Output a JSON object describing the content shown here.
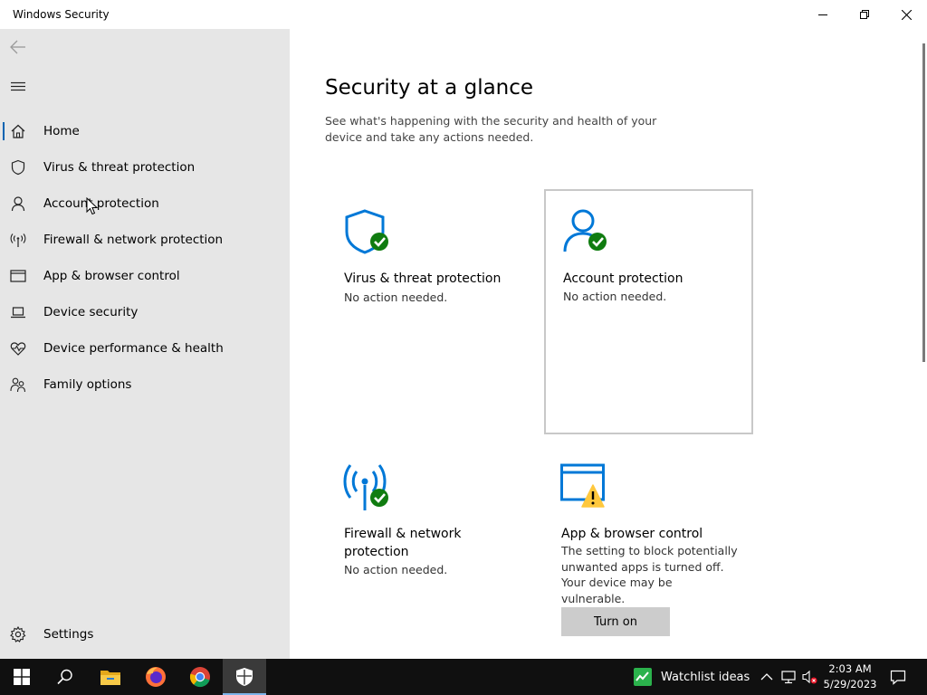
{
  "window": {
    "title": "Windows Security"
  },
  "sidebar": {
    "items": [
      {
        "label": "Home",
        "icon": "home-icon",
        "selected": true
      },
      {
        "label": "Virus & threat protection",
        "icon": "shield-icon"
      },
      {
        "label": "Account protection",
        "icon": "person-icon"
      },
      {
        "label": "Firewall & network protection",
        "icon": "antenna-icon"
      },
      {
        "label": "App & browser control",
        "icon": "browser-window-icon"
      },
      {
        "label": "Device security",
        "icon": "laptop-icon"
      },
      {
        "label": "Device performance & health",
        "icon": "heart-pulse-icon"
      },
      {
        "label": "Family options",
        "icon": "family-icon"
      }
    ],
    "settings_label": "Settings"
  },
  "main": {
    "title": "Security at a glance",
    "description": "See what's happening with the security and health of your device and take any actions needed.",
    "tiles": [
      {
        "title": "Virus & threat protection",
        "status": "No action needed.",
        "icon": "shield-check-icon"
      },
      {
        "title": "Account protection",
        "status": "No action needed.",
        "icon": "person-check-icon"
      },
      {
        "title": "Firewall & network protection",
        "status": "No action needed.",
        "icon": "antenna-check-icon"
      },
      {
        "title": "App & browser control",
        "status": "The setting to block potentially unwanted apps is turned off. Your device may be vulnerable.",
        "icon": "browser-warning-icon",
        "button": "Turn on"
      }
    ]
  },
  "taskbar": {
    "watchlist_label": "Watchlist ideas",
    "time": "2:03 AM",
    "date": "5/29/2023",
    "apps": [
      "start-icon",
      "search-icon",
      "file-explorer-icon",
      "firefox-icon",
      "chrome-icon",
      "windows-security-icon"
    ]
  },
  "colors": {
    "accent": "#0063b1",
    "icon_blue": "#0078d7",
    "ok_green": "#107c10",
    "warning_yellow": "#ffc83d",
    "sidebar_bg": "#e6e6e6",
    "taskbar_bg": "#101010"
  }
}
